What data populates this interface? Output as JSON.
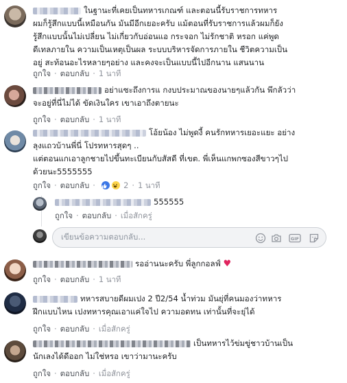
{
  "comments": [
    {
      "name": "",
      "lines": [
        "ในฐานะที่เคยเป็นทหารเกณฑ์ และตอนนี้รับราชการทหาร",
        "ผมก็รู้สึกแบบนี้เหมือนกัน มันมีอีกเยอะครับ แม้ตอนที่รับราชการแล้วผมก็ยัง",
        "รู้สึกแบบนั้นไม่เปลี่ยน ไม่เกี่ยวกับอ่อนแอ กระจอก ไม่รักชาติ หรอก แค่พูด",
        "ดีเทลภายใน ความเป็นเหตุเป็นผล ระบบบริหารจัดการภายใน ชีวิตความเป็น",
        "อยู่ สะท้อนอะไรหลายๆอย่าง และคงจะเป็นแบบนี้ไปอีกนาน แสนนาน"
      ],
      "like": "ถูกใจ",
      "reply": "ตอบกลับ",
      "time": "1 นาที"
    },
    {
      "name": "",
      "lines": [
        "อย่าแซะถึงการแ กงบประมาณของนายๆแล้วกัน พึกลัวว่า",
        "จะอยู่ที่นี่ไม่ได้ ขัดเงินใคร เขาเอาถึงตายนะ"
      ],
      "like": "ถูกใจ",
      "reply": "ตอบกลับ",
      "time": "1 นาที"
    },
    {
      "name": "",
      "lines": [
        "โอ้ยน้อง ไม่พูดงี้ คนรักทหารเยอะแยะ อย่าง",
        "ลุงแถวบ้านพี่นี่ โปรทหารสุดๆ ..",
        "แต่ตอนแกเอาลูกชายไปขึ้นทะเบียนกับสัสดี ที่เขต. พี่เห็นแกพกซองสีขาวๆไป",
        "ด้วยนะ5555555"
      ],
      "like": "ถูกใจ",
      "reply": "ตอบกลับ",
      "reaction_count": "2",
      "time": "1 นาที"
    },
    {
      "name": "",
      "lines": [
        "555555"
      ],
      "like": "ถูกใจ",
      "reply": "ตอบกลับ",
      "time": "เมื่อสักครู่"
    },
    {
      "name": "",
      "lines": [
        "รออ่านนะครับ พี่ลูกกอลฟ์ ♥"
      ],
      "like": "ถูกใจ",
      "reply": "ตอบกลับ",
      "time": "1 นาที"
    },
    {
      "name": "",
      "lines": [
        "ทหารสบายดีผมเปง 2 ปี2/54 น้ำท่วม มันยุ่ที่คนมองว่าทหาร",
        "ฝึกแบบไหน เปงทหารคุณเอาแค่ใจไป ความอดทน เท่านั้นที่จะยุ่ได้"
      ],
      "like": "ถูกใจ",
      "reply": "ตอบกลับ",
      "time": "เมื่อสักครู่"
    },
    {
      "name": "",
      "lines": [
        "เป็นทหารไว้ข่มขู่ชาวบ้านเป็น",
        "นักเลงได้ดีออก ไม่ใช่หรอ เขาว่ามานะครับ"
      ],
      "like": "ถูกใจ",
      "reply": "ตอบกลับ",
      "time": "เมื่อสักครู่"
    }
  ],
  "reply_box": {
    "placeholder": "เขียนข้อความตอบกลับ..."
  },
  "icons": [
    "emoji-icon",
    "camera-icon",
    "gif-icon",
    "sticker-icon"
  ],
  "colors": {
    "link": "#4b4f56",
    "meta": "#90949c",
    "like_reaction": "#3b77e6",
    "haha_reaction": "#fbd34b",
    "heart": "#e0245e"
  }
}
